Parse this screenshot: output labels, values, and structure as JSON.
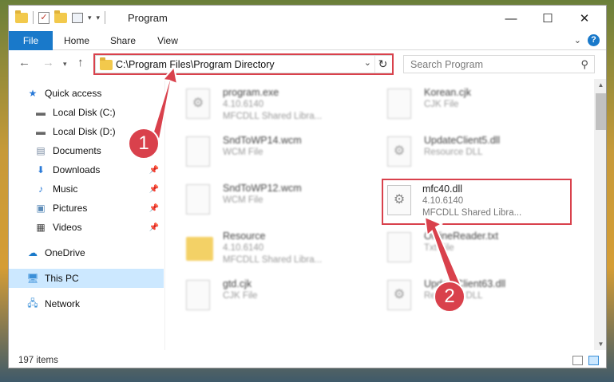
{
  "window": {
    "title": "Program"
  },
  "ribbon": {
    "tabs": [
      "File",
      "Home",
      "Share",
      "View"
    ]
  },
  "nav": {
    "address": "C:\\Program Files\\Program Directory",
    "search_placeholder": "Search Program"
  },
  "sidebar": {
    "items": [
      {
        "label": "Quick access",
        "icon": "star-icon"
      },
      {
        "label": "Local Disk (C:)",
        "icon": "drive-icon"
      },
      {
        "label": "Local Disk (D:)",
        "icon": "drive-icon"
      },
      {
        "label": "Documents",
        "icon": "documents-icon"
      },
      {
        "label": "Downloads",
        "icon": "download-icon"
      },
      {
        "label": "Music",
        "icon": "music-icon"
      },
      {
        "label": "Pictures",
        "icon": "pictures-icon"
      },
      {
        "label": "Videos",
        "icon": "videos-icon"
      },
      {
        "label": "OneDrive",
        "icon": "cloud-icon"
      },
      {
        "label": "This PC",
        "icon": "computer-icon"
      },
      {
        "label": "Network",
        "icon": "network-icon"
      }
    ]
  },
  "files": [
    {
      "name": "program.exe",
      "line2": "4.10.6140",
      "line3": "MFCDLL Shared Libra..."
    },
    {
      "name": "Korean.cjk",
      "line2": "CJK File",
      "line3": ""
    },
    {
      "name": "SndToWP14.wcm",
      "line2": "WCM File",
      "line3": ""
    },
    {
      "name": "UpdateClient5.dll",
      "line2": "Resource DLL",
      "line3": ""
    },
    {
      "name": "SndToWP12.wcm",
      "line2": "WCM File",
      "line3": ""
    },
    {
      "name": "mfc40.dll",
      "line2": "4.10.6140",
      "line3": "MFCDLL Shared Libra..."
    },
    {
      "name": "Resource",
      "line2": "4.10.6140",
      "line3": "MFCDLL Shared Libra..."
    },
    {
      "name": "OnlineReader.txt",
      "line2": "Txt File",
      "line3": ""
    },
    {
      "name": "gtd.cjk",
      "line2": "CJK File",
      "line3": ""
    },
    {
      "name": "UpdateClient63.dll",
      "line2": "Resource DLL",
      "line3": ""
    }
  ],
  "status": {
    "items": "197 items"
  },
  "callouts": [
    "1",
    "2"
  ],
  "colors": {
    "highlight": "#d9414c",
    "accent": "#1979ca",
    "selection": "#cce8ff"
  }
}
